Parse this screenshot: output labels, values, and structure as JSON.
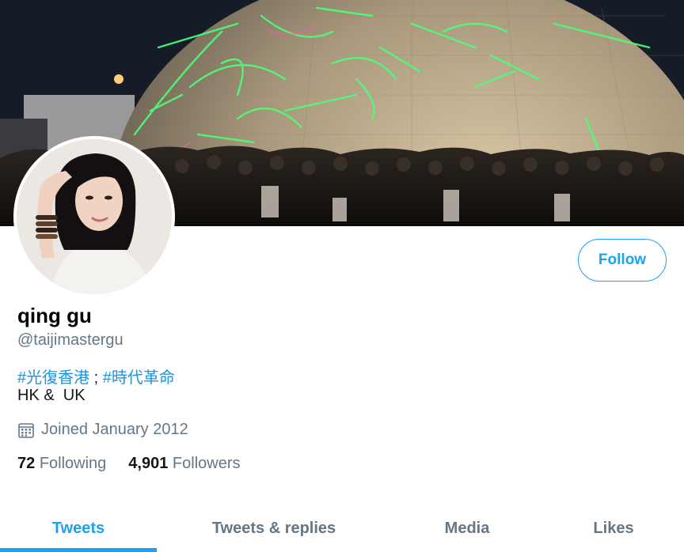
{
  "profile": {
    "display_name": "qing gu",
    "handle": "@taijimastergu",
    "bio_tag_1": "#光復香港",
    "bio_separator": " ; ",
    "bio_tag_2": "#時代革命",
    "location": "HK &  UK",
    "joined": "Joined January 2012"
  },
  "actions": {
    "follow_label": "Follow"
  },
  "stats": {
    "following_count": "72",
    "following_label": "Following",
    "followers_count": "4,901",
    "followers_label": "Followers"
  },
  "tabs": [
    {
      "label": "Tweets",
      "active": true
    },
    {
      "label": "Tweets & replies",
      "active": false
    },
    {
      "label": "Media",
      "active": false
    },
    {
      "label": "Likes",
      "active": false
    }
  ],
  "icons": {
    "joined": "calendar-icon"
  },
  "colors": {
    "accent": "#1da1f2",
    "hashtag": "#1b95e0",
    "secondary_text": "#657786",
    "primary_text": "#14171a"
  }
}
